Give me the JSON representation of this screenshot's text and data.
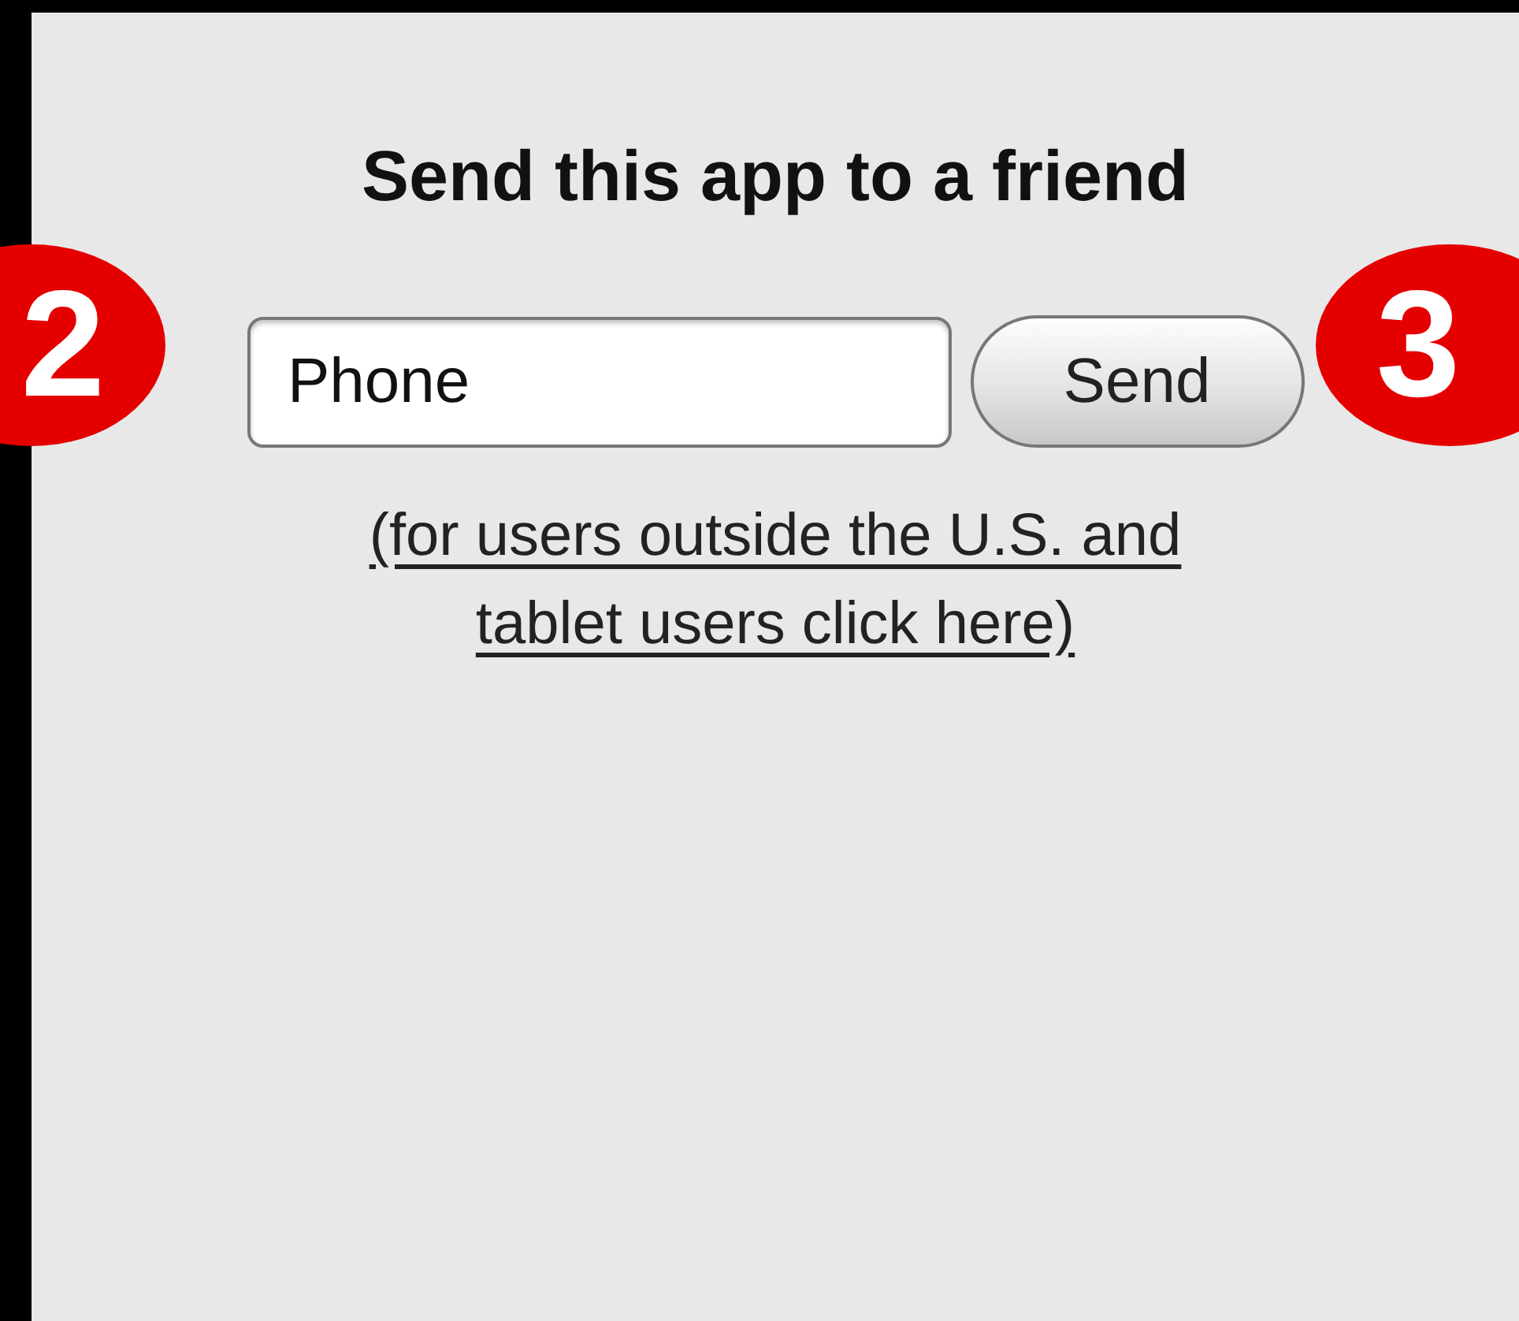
{
  "title": "Send this app to a friend",
  "phone_field": {
    "placeholder": "Phone"
  },
  "send_button": {
    "label": "Send"
  },
  "link": "(for users outside the U.S. and tablet users click here)",
  "badges": [
    {
      "label": "2"
    },
    {
      "label": "3"
    }
  ]
}
